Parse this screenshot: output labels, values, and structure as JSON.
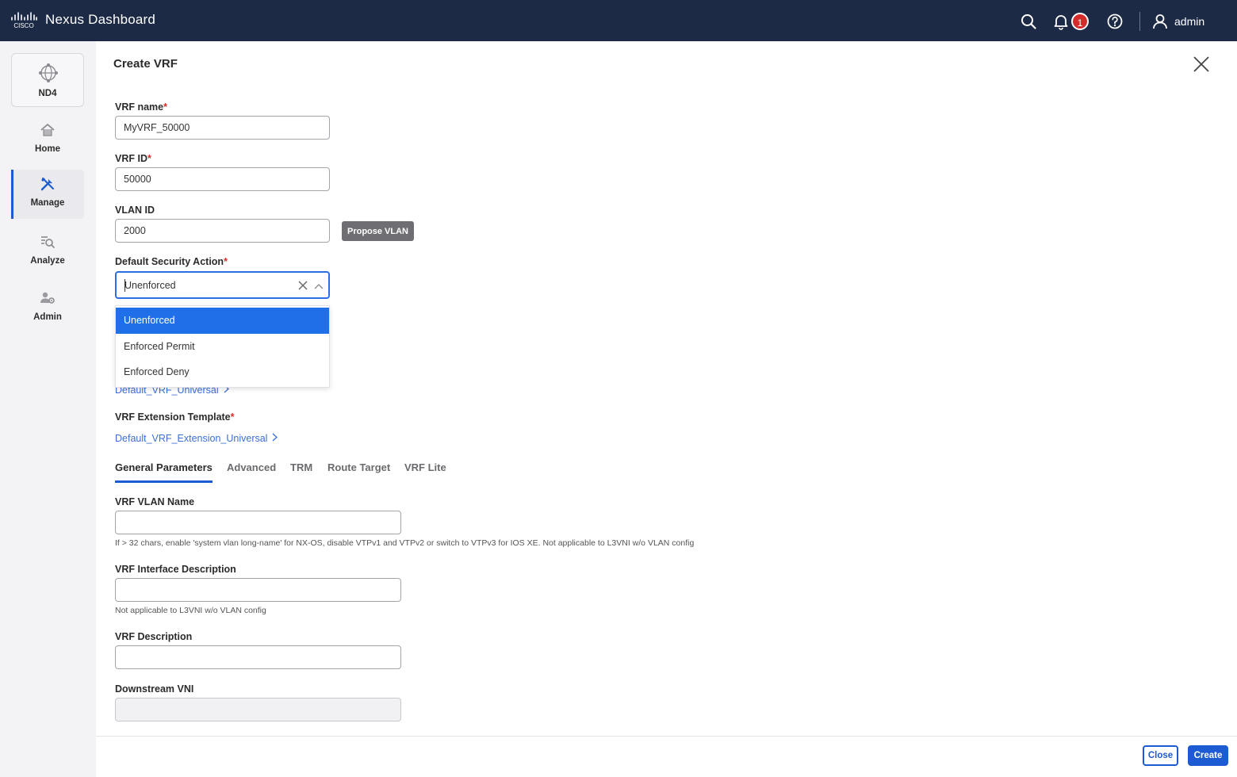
{
  "header": {
    "brand_logo": "CISCO",
    "app_title": "Nexus Dashboard",
    "notification_count": "1",
    "user_name": "admin"
  },
  "sidebar": {
    "site_label": "ND4",
    "items": [
      {
        "label": "Home",
        "icon": "home-icon"
      },
      {
        "label": "Manage",
        "icon": "tools-icon",
        "active": true
      },
      {
        "label": "Analyze",
        "icon": "analyze-icon"
      },
      {
        "label": "Admin",
        "icon": "admin-icon"
      }
    ]
  },
  "panel": {
    "title": "Create VRF",
    "vrf_name": {
      "label": "VRF name",
      "value": "MyVRF_50000"
    },
    "vrf_id": {
      "label": "VRF ID",
      "value": "50000"
    },
    "vlan_id": {
      "label": "VLAN ID",
      "value": "2000",
      "propose_label": "Propose VLAN"
    },
    "security_action": {
      "label": "Default Security Action",
      "value": "Unenforced",
      "options": [
        "Unenforced",
        "Enforced Permit",
        "Enforced Deny"
      ]
    },
    "vrf_template_link": "Default_VRF_Universal",
    "extension_template": {
      "label": "VRF Extension Template",
      "link": "Default_VRF_Extension_Universal"
    },
    "tabs": [
      "General Parameters",
      "Advanced",
      "TRM",
      "Route Target",
      "VRF Lite"
    ],
    "vlan_name": {
      "label": "VRF VLAN Name",
      "value": "",
      "help": "If > 32 chars, enable 'system vlan long-name' for NX-OS, disable VTPv1 and VTPv2 or switch to VTPv3 for IOS XE. Not applicable to L3VNI w/o VLAN config"
    },
    "interface_description": {
      "label": "VRF Interface Description",
      "value": "",
      "help": "Not applicable to L3VNI w/o VLAN config"
    },
    "description": {
      "label": "VRF Description",
      "value": ""
    },
    "downstream_vni": {
      "label": "Downstream VNI",
      "value": ""
    }
  },
  "footer": {
    "close_label": "Close",
    "create_label": "Create"
  },
  "colors": {
    "topbar": "#1c2a45",
    "accent": "#1c5bd1",
    "required": "#d62b2b",
    "selected_option": "#1f6fe8",
    "link": "#3b6fd6"
  }
}
